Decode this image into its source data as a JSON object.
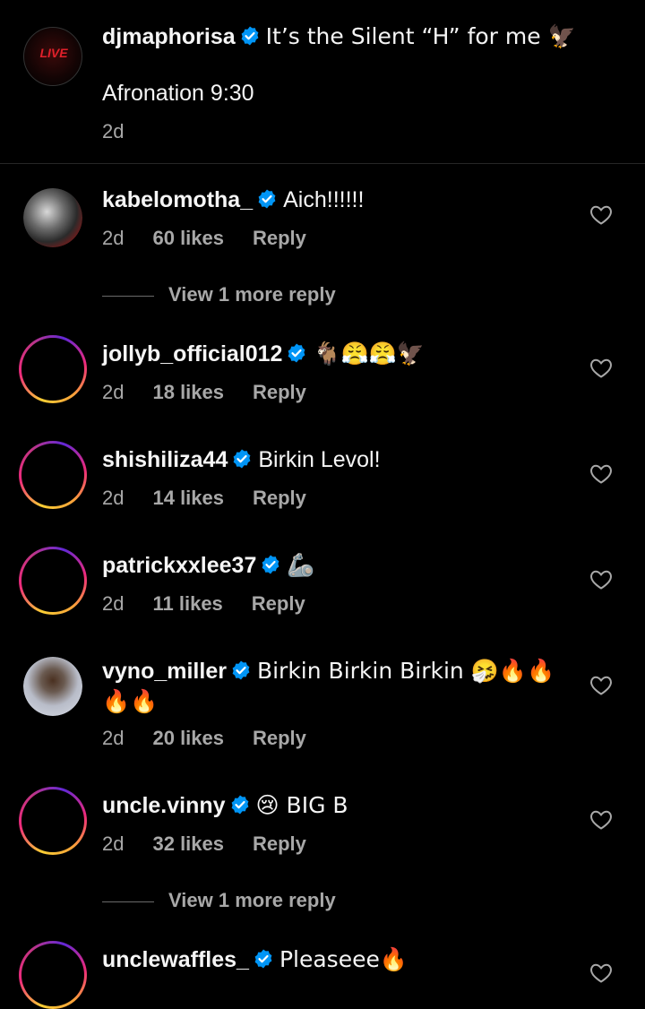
{
  "colors": {
    "background": "#000000",
    "text": "#f5f5f5",
    "muted": "#a8a8a8",
    "verified": "#0095f6"
  },
  "caption": {
    "username": "djmaphorisa",
    "text": "It’s the Silent “H” for me 🦅",
    "second_line": "Afronation 9:30",
    "time": "2d",
    "avatar_text": "LIVE"
  },
  "comments": [
    {
      "username": "kabelomotha_",
      "text": "Aich!!!!!!",
      "time": "2d",
      "likes": "60 likes",
      "reply": "Reply",
      "view_more": "View 1 more reply"
    },
    {
      "username": "jollyb_official012",
      "text": "🐐😤😤🦅",
      "time": "2d",
      "likes": "18 likes",
      "reply": "Reply"
    },
    {
      "username": "shishiliza44",
      "text": "Birkin Levol!",
      "time": "2d",
      "likes": "14 likes",
      "reply": "Reply"
    },
    {
      "username": "patrickxxlee37",
      "text": "🦾",
      "time": "2d",
      "likes": "11 likes",
      "reply": "Reply"
    },
    {
      "username": "vyno_miller",
      "text": "Birkin Birkin Birkin 🤧🔥🔥",
      "text_line2": "🔥🔥",
      "time": "2d",
      "likes": "20 likes",
      "reply": "Reply"
    },
    {
      "username": "uncle.vinny",
      "text": "😢 BIG B",
      "time": "2d",
      "likes": "32 likes",
      "reply": "Reply",
      "view_more": "View 1 more reply"
    },
    {
      "username": "unclewaffles_",
      "text": "Pleaseee🔥"
    }
  ],
  "icons": {
    "verified": "verified-badge-icon",
    "like": "heart-outline-icon"
  }
}
